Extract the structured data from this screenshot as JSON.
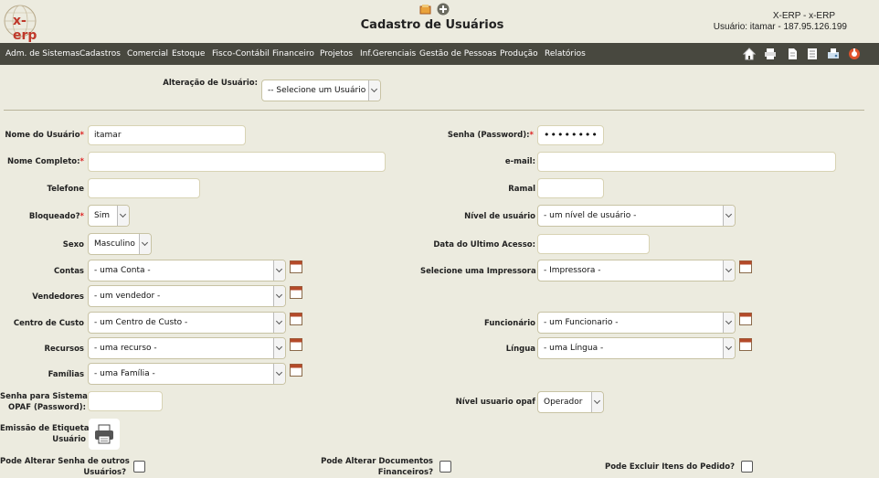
{
  "header": {
    "logo_text": "x-erp",
    "title": "Cadastro de Usuários",
    "system_name": "X-ERP - x-ERP",
    "user_info": "Usuário: itamar - 187.95.126.199"
  },
  "menu": {
    "items": [
      {
        "label": "Adm. de Sistemas"
      },
      {
        "label": "Cadastros"
      },
      {
        "label": "Comercial"
      },
      {
        "label": "Estoque"
      },
      {
        "label": "Fisco-Contábil"
      },
      {
        "label": "Financeiro"
      },
      {
        "label": "Projetos"
      },
      {
        "label": "Inf.Gerenciais"
      },
      {
        "label": "Gestão de Pessoas"
      },
      {
        "label": "Produção"
      },
      {
        "label": "Relatórios"
      }
    ],
    "toolbar_icons": [
      "home-icon",
      "print-icon",
      "document-icon",
      "notes-icon",
      "fax-icon",
      "logout-icon"
    ]
  },
  "user_select": {
    "label": "Alteração de Usuário:",
    "value": "-- Selecione um Usuário --"
  },
  "form": {
    "nome_usuario": {
      "label": "Nome do Usuário",
      "value": "itamar"
    },
    "senha": {
      "label": "Senha (Password):",
      "value": "••••••••"
    },
    "nome_completo": {
      "label": "Nome Completo:",
      "value": ""
    },
    "email": {
      "label": "e-mail:",
      "value": ""
    },
    "telefone": {
      "label": "Telefone",
      "value": ""
    },
    "ramal": {
      "label": "Ramal",
      "value": ""
    },
    "bloqueado": {
      "label": "Bloqueado?",
      "value": "Sim"
    },
    "nivel_usuario": {
      "label": "Nível de usuário",
      "value": "- um nível de usuário -"
    },
    "sexo": {
      "label": "Sexo",
      "value": "Masculino"
    },
    "data_ultimo_acesso": {
      "label": "Data do Ultimo Acesso:",
      "value": ""
    },
    "contas": {
      "label": "Contas",
      "value": "- uma Conta -"
    },
    "impressora": {
      "label": "Selecione uma Impressora",
      "value": "- Impressora -"
    },
    "vendedores": {
      "label": "Vendedores",
      "value": "- um vendedor -"
    },
    "centro_custo": {
      "label": "Centro de Custo",
      "value": "- um Centro de Custo -"
    },
    "funcionario": {
      "label": "Funcionário",
      "value": "- um Funcionario -"
    },
    "recursos": {
      "label": "Recursos",
      "value": "- uma recurso -"
    },
    "lingua": {
      "label": "Língua",
      "value": "- uma Língua -"
    },
    "familias": {
      "label": "Famílias",
      "value": "- uma Família -"
    },
    "senha_opaf_line1": "Senha para Sistema",
    "senha_opaf_line2": "OPAF (Password):",
    "nivel_opaf": {
      "label": "Nível usuario opaf",
      "value": "Operador"
    },
    "etiqueta_line1": "Emissão de Etiqueta de",
    "etiqueta_line2": "Usuário",
    "pode_alterar_senha_line1": "Pode Alterar Senha de outros",
    "pode_alterar_senha_line2": "Usuários?",
    "pode_alterar_docs_line1": "Pode Alterar Documentos",
    "pode_alterar_docs_line2": "Financeiros?",
    "pode_excluir_itens": "Pode Excluir Itens do Pedido?"
  },
  "colors": {
    "background": "#ecebdf",
    "menubar": "#48483f",
    "required": "#dd2222",
    "accent": "#c0392b"
  }
}
